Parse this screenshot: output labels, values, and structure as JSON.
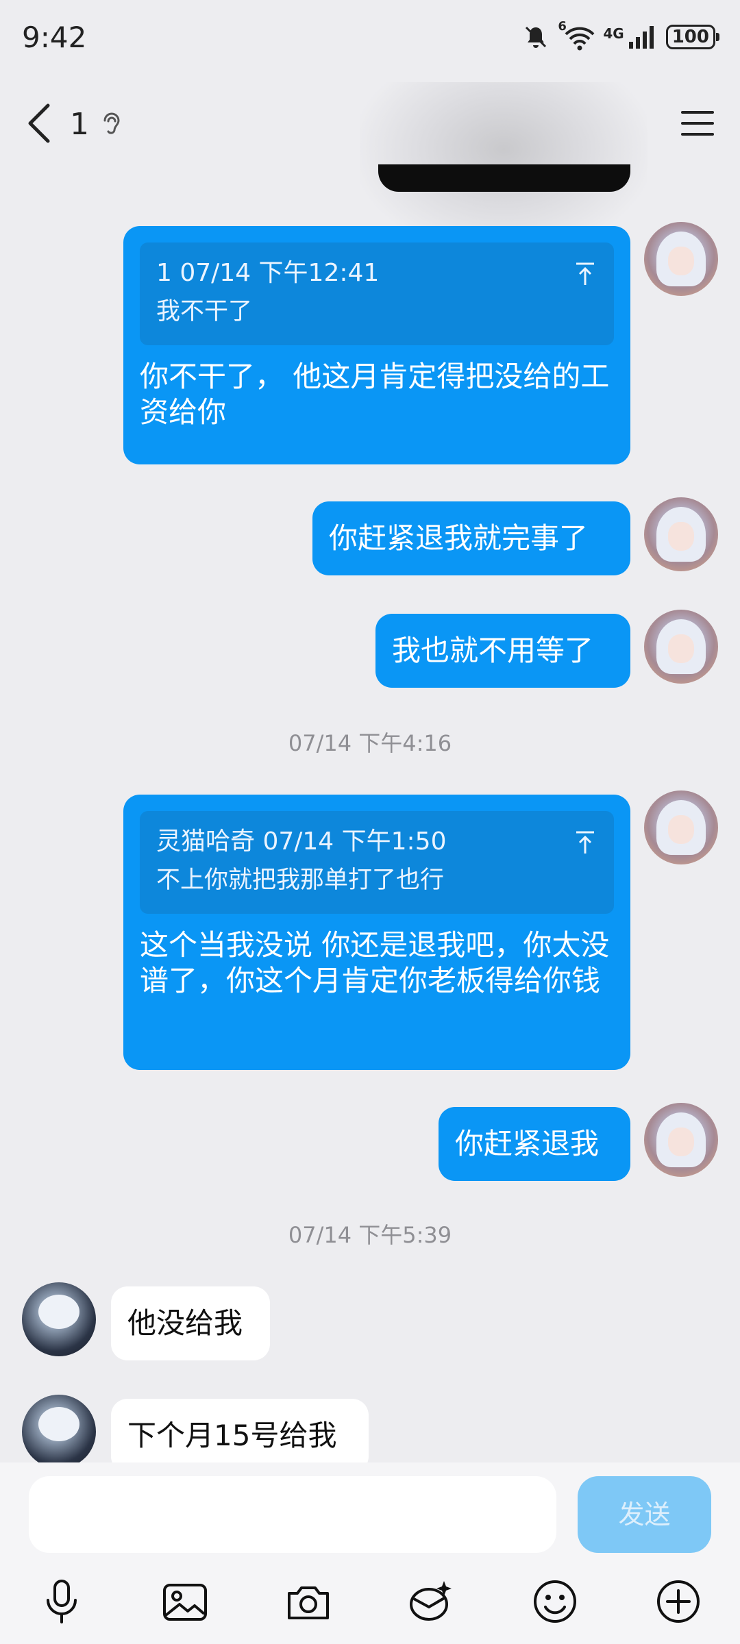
{
  "status_bar": {
    "time": "9:42",
    "signal_badge": "6",
    "network": "4G",
    "battery": "100"
  },
  "header": {
    "title": "1"
  },
  "messages": [
    {
      "type": "sent",
      "quote_head": "1 07/14 下午12:41",
      "quote_body": "我不干了",
      "text": "你不干了， 他这月肯定得把没给的工资给你"
    },
    {
      "type": "sent",
      "text": "你赶紧退我就完事了"
    },
    {
      "type": "sent",
      "text": "我也就不用等了"
    },
    {
      "type": "time",
      "text": "07/14 下午4:16"
    },
    {
      "type": "sent",
      "quote_head": "灵猫哈奇 07/14 下午1:50",
      "quote_body": "不上你就把我那单打了也行",
      "text": "这个当我没说 你还是退我吧，你太没谱了，你这个月肯定你老板得给你钱"
    },
    {
      "type": "sent",
      "text": "你赶紧退我"
    },
    {
      "type": "time",
      "text": "07/14 下午5:39"
    },
    {
      "type": "received",
      "text": "他没给我"
    },
    {
      "type": "received",
      "text": "下个月15号给我"
    }
  ],
  "input": {
    "placeholder": "",
    "send_label": "发送"
  },
  "toolbar": [
    "microphone-icon",
    "image-icon",
    "camera-icon",
    "sticker-icon",
    "emoji-icon",
    "plus-icon"
  ]
}
